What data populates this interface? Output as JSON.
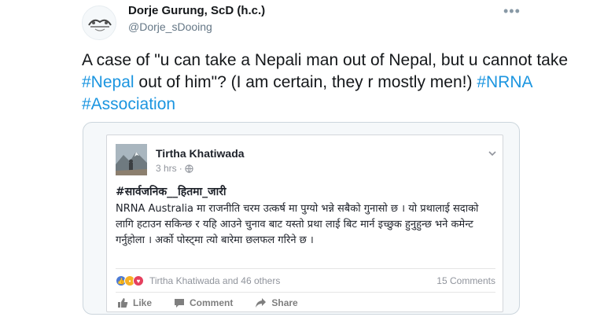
{
  "tweet": {
    "author_name": "Dorje Gurung, ScD (h.c.)",
    "author_handle": "@Dorje_sDooing",
    "more_label": "•••",
    "text_parts": {
      "p1": "A case of \"u can take a Nepali man out of Nepal, but u cannot take ",
      "tag1": "#Nepal",
      "p2": " out of him\"? (I am certain, they r mostly men!) ",
      "tag2": "#NRNA",
      "p3": " ",
      "tag3": "#Association"
    }
  },
  "embed": {
    "post_author": "Tirtha Khatiwada",
    "post_time": "3 hrs",
    "meta_sep": "·",
    "hashtag": "#सार्वजनिक__हितमा_जारी",
    "body_text": "NRNA Australia मा राजनीति चरम उत्कर्ष मा पुग्यो भन्ने सबैको गुनासो छ । यो प्रथालाई सदाको लागि हटाउन सकिन्छ र यहि आउने चुनाव बाट यस्तो प्रथा लाई बिट मार्न इच्छुक हुनुहुन्छ भने कमेन्ट गर्नुहोला । अर्को पोस्ट्मा त्यो बारेमा छलफल गरिने छ ।",
    "reactions_text": "Tirtha Khatiwada and 46 others",
    "comments_text": "15 Comments",
    "actions": {
      "like": "Like",
      "comment": "Comment",
      "share": "Share"
    }
  },
  "colors": {
    "link": "#1b95e0",
    "fb_blue": "#4c7ad4",
    "fb_grey": "#90949c"
  }
}
